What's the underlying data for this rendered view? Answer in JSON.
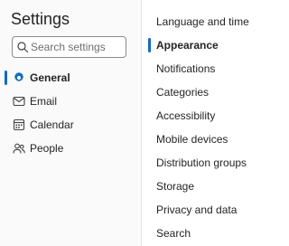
{
  "sidebar": {
    "title": "Settings",
    "search": {
      "placeholder": "Search settings",
      "value": ""
    },
    "items": [
      {
        "label": "General",
        "icon": "gear-icon",
        "active": true
      },
      {
        "label": "Email",
        "icon": "mail-icon",
        "active": false
      },
      {
        "label": "Calendar",
        "icon": "calendar-icon",
        "active": false
      },
      {
        "label": "People",
        "icon": "people-icon",
        "active": false
      }
    ]
  },
  "general_menu": {
    "items": [
      {
        "label": "Language and time",
        "active": false
      },
      {
        "label": "Appearance",
        "active": true
      },
      {
        "label": "Notifications",
        "active": false
      },
      {
        "label": "Categories",
        "active": false
      },
      {
        "label": "Accessibility",
        "active": false
      },
      {
        "label": "Mobile devices",
        "active": false
      },
      {
        "label": "Distribution groups",
        "active": false
      },
      {
        "label": "Storage",
        "active": false
      },
      {
        "label": "Privacy and data",
        "active": false
      },
      {
        "label": "Search",
        "active": false
      }
    ]
  },
  "colors": {
    "accent": "#0f6cbd",
    "text": "#242424",
    "pane_background": "#fafafa",
    "divider": "#e6e6e6"
  }
}
